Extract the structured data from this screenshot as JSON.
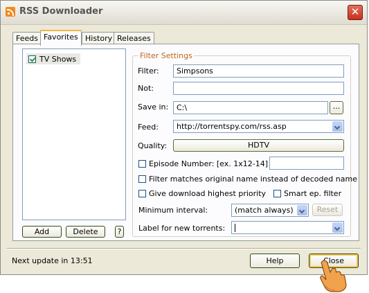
{
  "window": {
    "title": "RSS Downloader",
    "close_glyph": "✕"
  },
  "tabs": [
    {
      "label": "Feeds"
    },
    {
      "label": "Favorites"
    },
    {
      "label": "History"
    },
    {
      "label": "Releases"
    }
  ],
  "favorites": {
    "items": [
      {
        "label": "TV Shows",
        "checked": true
      }
    ],
    "add_label": "Add",
    "delete_label": "Delete",
    "help_label": "?"
  },
  "filter_settings": {
    "legend": "Filter Settings",
    "filter_label": "Filter:",
    "filter_value": "Simpsons",
    "not_label": "Not:",
    "not_value": "",
    "save_in_label": "Save in:",
    "save_in_value": "C:\\",
    "browse_label": "...",
    "feed_label": "Feed:",
    "feed_value": "http://torrentspy.com/rss.asp",
    "quality_label": "Quality:",
    "quality_value": "HDTV",
    "episode_label": "Episode Number: [ex. 1x12-14]",
    "episode_value": "",
    "match_original_label": "Filter matches original name instead of decoded name",
    "priority_label": "Give download highest priority",
    "smart_ep_label": "Smart ep. filter",
    "min_interval_label": "Minimum interval:",
    "min_interval_value": "(match always)",
    "reset_label": "Reset",
    "label_new_label": "Label for new torrents:",
    "label_new_value": ""
  },
  "footer": {
    "status": "Next update in 13:51",
    "help_label": "Help",
    "close_label": "Close"
  },
  "colors": {
    "accent_tab": "#f3b73f",
    "legend": "#c2651b",
    "close": "#c6321c"
  }
}
